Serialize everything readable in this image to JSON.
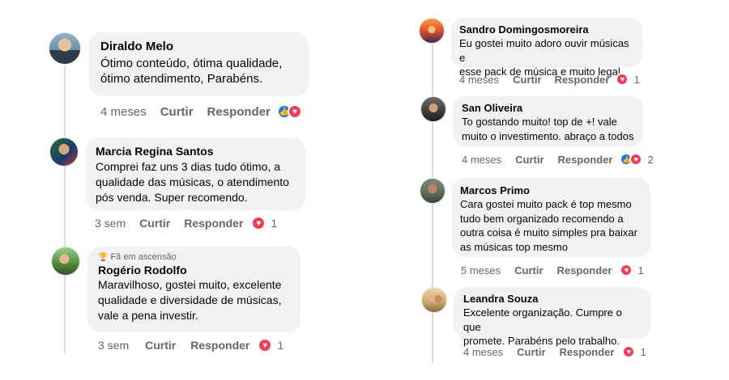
{
  "left": [
    {
      "author": "Diraldo Melo",
      "text": "Ótimo conteúdo, ótima qualidade,\nótimo atendimento, Parabéns.",
      "time": "4 meses",
      "like_label": "Curtir",
      "reply_label": "Responder",
      "reactions": [
        "like",
        "love"
      ],
      "reaction_count": ""
    },
    {
      "author": "Marcia Regina Santos",
      "text": "Comprei faz uns 3 dias tudo ótimo, a\nqualidade das músicas, o atendimento\npós  venda. Super recomendo.",
      "time": "3 sem",
      "like_label": "Curtir",
      "reply_label": "Responder",
      "reactions": [
        "love"
      ],
      "reaction_count": "1"
    },
    {
      "badge": "Fã em ascensão",
      "author": "Rogério Rodolfo",
      "text": "Maravilhoso, gostei muito, excelente\nqualidade e diversidade de músicas,\nvale a pena investir.",
      "time": "3 sem",
      "like_label": "Curtir",
      "reply_label": "Responder",
      "reactions": [
        "love"
      ],
      "reaction_count": "1"
    }
  ],
  "right": [
    {
      "author": "Sandro Domingosmoreira",
      "text": "Eu gostei muito adoro ouvir músicas e\nesse pack de música e muito legal",
      "time": "4 meses",
      "like_label": "Curtir",
      "reply_label": "Responder",
      "reactions": [
        "love"
      ],
      "reaction_count": "1"
    },
    {
      "author": "San Oliveira",
      "text": "To gostando muito! top de +!  vale\nmuito o investimento. abraço a todos",
      "time": "4 meses",
      "like_label": "Curtir",
      "reply_label": "Responder",
      "reactions": [
        "like",
        "love"
      ],
      "reaction_count": "2"
    },
    {
      "author": "Marcos Primo",
      "text": "Cara gostei muito pack é top mesmo\ntudo bem organizado recomendo a\noutra coisa é muito simples pra baixar\nas músicas top mesmo",
      "time": "5 meses",
      "like_label": "Curtir",
      "reply_label": "Responder",
      "reactions": [
        "love"
      ],
      "reaction_count": "1"
    },
    {
      "author": "Leandra Souza",
      "text": "Excelente organização. Cumpre o que\npromete. Parabéns pelo trabalho.",
      "time": "4 meses",
      "like_label": "Curtir",
      "reply_label": "Responder",
      "reactions": [
        "love"
      ],
      "reaction_count": "1"
    }
  ],
  "colors": {
    "bubble": "#f0f2f5",
    "meta_text": "#65676b",
    "like_blue": "#1877f2",
    "love_red": "#f33e58",
    "thread_line": "#dadde1"
  }
}
